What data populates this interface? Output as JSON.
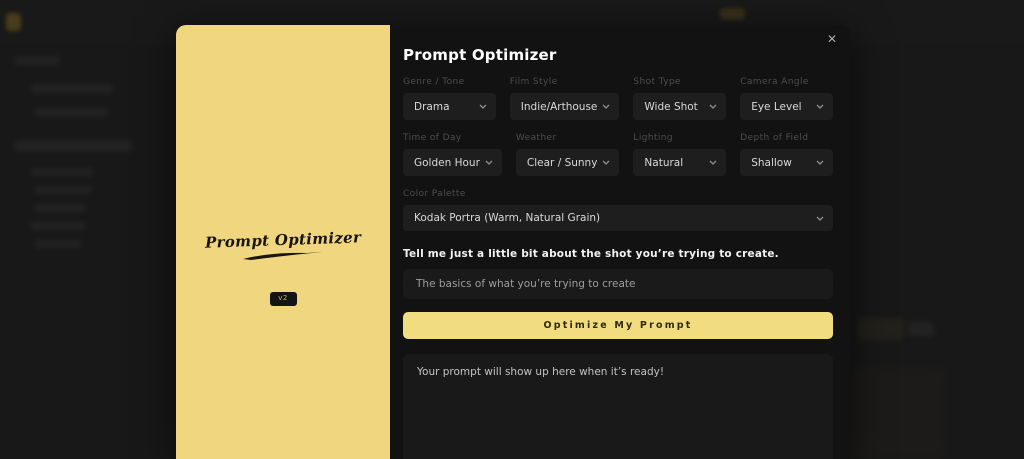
{
  "colors": {
    "accent_yellow": "#f0d77f",
    "button_yellow": "#f2dc80",
    "modal_bg": "#121212",
    "field_bg": "#1e1e1e"
  },
  "brand_panel": {
    "title": "Prompt Optimizer",
    "version_badge": "v2"
  },
  "modal": {
    "title": "Prompt Optimizer",
    "close_label": "✕",
    "fields": [
      {
        "label": "Genre / Tone",
        "value": "Drama"
      },
      {
        "label": "Film Style",
        "value": "Indie/Arthouse"
      },
      {
        "label": "Shot Type",
        "value": "Wide Shot"
      },
      {
        "label": "Camera Angle",
        "value": "Eye Level"
      },
      {
        "label": "Time of Day",
        "value": "Golden Hour"
      },
      {
        "label": "Weather",
        "value": "Clear / Sunny"
      },
      {
        "label": "Lighting",
        "value": "Natural"
      },
      {
        "label": "Depth of Field",
        "value": "Shallow"
      }
    ],
    "color_palette": {
      "label": "Color Palette",
      "value": "Kodak Portra (Warm, Natural Grain)"
    },
    "question": "Tell me just a little bit about the shot you’re trying to create.",
    "input_placeholder": "The basics of what you’re trying to create",
    "optimize_button": "Optimize My Prompt",
    "output_placeholder": "Your prompt will show up here when it’s ready!"
  }
}
